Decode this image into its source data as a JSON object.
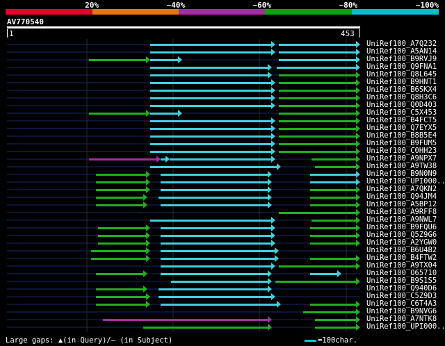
{
  "legend": {
    "labels": [
      "20%",
      "~40%",
      "~60%",
      "~80%",
      "~100%"
    ],
    "colors": [
      "#e8002c",
      "#e07818",
      "#a030a0",
      "#10a010",
      "#00c0c8"
    ]
  },
  "query": {
    "title": "AV770540",
    "start": "1",
    "end": "453"
  },
  "hits": [
    {
      "label": "UniRef100_A7Q232",
      "segments": [
        {
          "from": 216,
          "to": 396,
          "color": "cyan"
        },
        {
          "from": 401,
          "to": 518,
          "color": "cyan"
        }
      ]
    },
    {
      "label": "UniRef100_A5AN14",
      "segments": [
        {
          "from": 216,
          "to": 396,
          "color": "cyan"
        },
        {
          "from": 401,
          "to": 518,
          "color": "cyan"
        }
      ]
    },
    {
      "label": "UniRef100_B9RVJ9",
      "segments": [
        {
          "from": 128,
          "to": 216,
          "color": "green"
        },
        {
          "from": 216,
          "to": 262,
          "color": "cyan"
        },
        {
          "from": 401,
          "to": 518,
          "color": "cyan"
        }
      ]
    },
    {
      "label": "UniRef100_Q9FNA1",
      "segments": [
        {
          "from": 216,
          "to": 391,
          "color": "cyan"
        },
        {
          "from": 398,
          "to": 518,
          "color": "cyan"
        }
      ]
    },
    {
      "label": "UniRef100_Q8L645",
      "segments": [
        {
          "from": 216,
          "to": 391,
          "color": "cyan"
        },
        {
          "from": 401,
          "to": 518,
          "color": "green"
        }
      ]
    },
    {
      "label": "UniRef100_B9HNT1",
      "segments": [
        {
          "from": 216,
          "to": 396,
          "color": "cyan"
        },
        {
          "from": 401,
          "to": 518,
          "color": "green"
        }
      ]
    },
    {
      "label": "UniRef100_B6SKX4",
      "segments": [
        {
          "from": 216,
          "to": 396,
          "color": "cyan"
        },
        {
          "from": 401,
          "to": 518,
          "color": "green"
        }
      ]
    },
    {
      "label": "UniRef100_Q8H3C6",
      "segments": [
        {
          "from": 216,
          "to": 396,
          "color": "cyan"
        },
        {
          "from": 401,
          "to": 518,
          "color": "green"
        }
      ]
    },
    {
      "label": "UniRef100_Q0D403",
      "segments": [
        {
          "from": 216,
          "to": 396,
          "color": "cyan"
        },
        {
          "from": 401,
          "to": 518,
          "color": "green"
        }
      ]
    },
    {
      "label": "UniRef100_C5X453",
      "segments": [
        {
          "from": 128,
          "to": 216,
          "color": "green"
        },
        {
          "from": 216,
          "to": 262,
          "color": "cyan"
        },
        {
          "from": 401,
          "to": 518,
          "color": "green"
        }
      ]
    },
    {
      "label": "UniRef100_B4FCT5",
      "segments": [
        {
          "from": 216,
          "to": 396,
          "color": "cyan"
        },
        {
          "from": 401,
          "to": 518,
          "color": "green"
        }
      ]
    },
    {
      "label": "UniRef100_Q7EYX5",
      "segments": [
        {
          "from": 216,
          "to": 396,
          "color": "cyan"
        },
        {
          "from": 401,
          "to": 518,
          "color": "green"
        }
      ]
    },
    {
      "label": "UniRef100_B8B5E4",
      "segments": [
        {
          "from": 216,
          "to": 396,
          "color": "cyan"
        },
        {
          "from": 401,
          "to": 518,
          "color": "green"
        }
      ]
    },
    {
      "label": "UniRef100_B9FUM5",
      "segments": [
        {
          "from": 216,
          "to": 396,
          "color": "cyan"
        },
        {
          "from": 401,
          "to": 518,
          "color": "green"
        }
      ]
    },
    {
      "label": "UniRef100_C0HH23",
      "segments": [
        {
          "from": 216,
          "to": 396,
          "color": "cyan"
        },
        {
          "from": 401,
          "to": 518,
          "color": "green"
        }
      ]
    },
    {
      "label": "UniRef100_A9NPX7",
      "segments": [
        {
          "from": 128,
          "to": 231,
          "color": "purple"
        },
        {
          "from": 231,
          "to": 244,
          "color": "cyan"
        },
        {
          "from": 244,
          "to": 396,
          "color": "cyan"
        },
        {
          "from": 448,
          "to": 518,
          "color": "green"
        }
      ]
    },
    {
      "label": "UniRef100_A9TW38",
      "segments": [
        {
          "from": 216,
          "to": 404,
          "color": "cyan"
        },
        {
          "from": 453,
          "to": 518,
          "color": "green"
        }
      ]
    },
    {
      "label": "UniRef100_B9N0N9",
      "segments": [
        {
          "from": 138,
          "to": 216,
          "color": "green"
        },
        {
          "from": 231,
          "to": 391,
          "color": "cyan"
        },
        {
          "from": 446,
          "to": 518,
          "color": "cyan"
        }
      ]
    },
    {
      "label": "UniRef100_UPI000..",
      "segments": [
        {
          "from": 138,
          "to": 216,
          "color": "green"
        },
        {
          "from": 231,
          "to": 391,
          "color": "cyan"
        },
        {
          "from": 446,
          "to": 518,
          "color": "cyan"
        }
      ]
    },
    {
      "label": "UniRef100_A7QKN2",
      "segments": [
        {
          "from": 138,
          "to": 216,
          "color": "green"
        },
        {
          "from": 231,
          "to": 391,
          "color": "cyan"
        },
        {
          "from": 446,
          "to": 518,
          "color": "green"
        }
      ]
    },
    {
      "label": "UniRef100_Q94JM4",
      "segments": [
        {
          "from": 138,
          "to": 212,
          "color": "green"
        },
        {
          "from": 228,
          "to": 391,
          "color": "cyan"
        },
        {
          "from": 446,
          "to": 518,
          "color": "green"
        }
      ]
    },
    {
      "label": "UniRef100_A5BP12",
      "segments": [
        {
          "from": 138,
          "to": 212,
          "color": "green"
        },
        {
          "from": 231,
          "to": 391,
          "color": "cyan"
        },
        {
          "from": 446,
          "to": 518,
          "color": "green"
        }
      ]
    },
    {
      "label": "UniRef100_A9RFF8",
      "segments": [
        {
          "from": 401,
          "to": 518,
          "color": "green"
        }
      ]
    },
    {
      "label": "UniRef100_A9NWL7",
      "segments": [
        {
          "from": 216,
          "to": 396,
          "color": "cyan"
        },
        {
          "from": 448,
          "to": 518,
          "color": "green"
        }
      ]
    },
    {
      "label": "UniRef100_B9FQU6",
      "segments": [
        {
          "from": 141,
          "to": 216,
          "color": "green"
        },
        {
          "from": 231,
          "to": 396,
          "color": "cyan"
        },
        {
          "from": 446,
          "to": 518,
          "color": "green"
        }
      ]
    },
    {
      "label": "UniRef100_Q5Z9G6",
      "segments": [
        {
          "from": 141,
          "to": 216,
          "color": "green"
        },
        {
          "from": 231,
          "to": 396,
          "color": "cyan"
        },
        {
          "from": 446,
          "to": 518,
          "color": "green"
        }
      ]
    },
    {
      "label": "UniRef100_A2YGW0",
      "segments": [
        {
          "from": 141,
          "to": 216,
          "color": "green"
        },
        {
          "from": 231,
          "to": 396,
          "color": "cyan"
        },
        {
          "from": 446,
          "to": 518,
          "color": "green"
        }
      ]
    },
    {
      "label": "UniRef100_B6U4B2",
      "segments": [
        {
          "from": 131,
          "to": 216,
          "color": "green"
        },
        {
          "from": 231,
          "to": 401,
          "color": "cyan"
        }
      ]
    },
    {
      "label": "UniRef100_B4FTW2",
      "segments": [
        {
          "from": 131,
          "to": 216,
          "color": "green"
        },
        {
          "from": 231,
          "to": 401,
          "color": "cyan"
        },
        {
          "from": 446,
          "to": 518,
          "color": "green"
        }
      ]
    },
    {
      "label": "UniRef100_A9TX04",
      "segments": [
        {
          "from": 231,
          "to": 396,
          "color": "cyan"
        },
        {
          "from": 401,
          "to": 518,
          "color": "green"
        }
      ]
    },
    {
      "label": "UniRef100_O65710",
      "segments": [
        {
          "from": 138,
          "to": 212,
          "color": "green"
        },
        {
          "from": 231,
          "to": 391,
          "color": "cyan"
        },
        {
          "from": 446,
          "to": 491,
          "color": "cyan"
        }
      ]
    },
    {
      "label": "UniRef100_B9S1S5",
      "segments": [
        {
          "from": 246,
          "to": 391,
          "color": "cyan"
        },
        {
          "from": 396,
          "to": 518,
          "color": "green"
        }
      ]
    },
    {
      "label": "UniRef100_Q940D6",
      "segments": [
        {
          "from": 138,
          "to": 212,
          "color": "green"
        },
        {
          "from": 228,
          "to": 391,
          "color": "cyan"
        }
      ]
    },
    {
      "label": "UniRef100_C5Z9D3",
      "segments": [
        {
          "from": 138,
          "to": 216,
          "color": "green"
        },
        {
          "from": 228,
          "to": 396,
          "color": "cyan"
        }
      ]
    },
    {
      "label": "UniRef100_C6T4A3",
      "segments": [
        {
          "from": 138,
          "to": 216,
          "color": "green"
        },
        {
          "from": 231,
          "to": 404,
          "color": "cyan"
        },
        {
          "from": 446,
          "to": 518,
          "color": "green"
        }
      ]
    },
    {
      "label": "UniRef100_B9NVG6",
      "segments": [
        {
          "from": 436,
          "to": 518,
          "color": "green"
        }
      ]
    },
    {
      "label": "UniRef100_A7NTK8",
      "segments": [
        {
          "from": 148,
          "to": 391,
          "color": "purple"
        },
        {
          "from": 453,
          "to": 518,
          "color": "green"
        }
      ]
    },
    {
      "label": "UniRef100_UPI000..",
      "segments": [
        {
          "from": 206,
          "to": 391,
          "color": "green"
        },
        {
          "from": 453,
          "to": 518,
          "color": "green"
        }
      ]
    }
  ],
  "footer": {
    "gaps_text": "Large gaps: ▲(in Query)/– (in Subject)",
    "scale_text": "=100char."
  }
}
